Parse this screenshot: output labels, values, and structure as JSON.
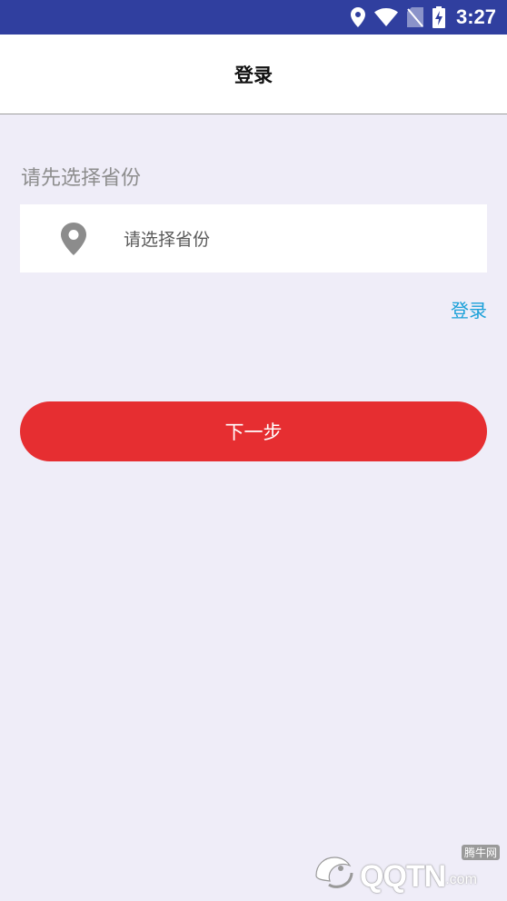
{
  "status_bar": {
    "time": "3:27",
    "icons": [
      "location-icon",
      "wifi-icon",
      "no-sim-icon",
      "battery-charging-icon"
    ]
  },
  "app_bar": {
    "title": "登录"
  },
  "form": {
    "prompt": "请先选择省份",
    "province_placeholder": "请选择省份",
    "login_link": "登录",
    "next_button": "下一步"
  },
  "watermark": {
    "brand_text": "QQTN",
    "domain_suffix": ".com",
    "cn_text": "腾牛网"
  },
  "colors": {
    "status_bar": "#303f9f",
    "background": "#efedf8",
    "primary_button": "#e62e31",
    "link": "#1aa0d8"
  }
}
